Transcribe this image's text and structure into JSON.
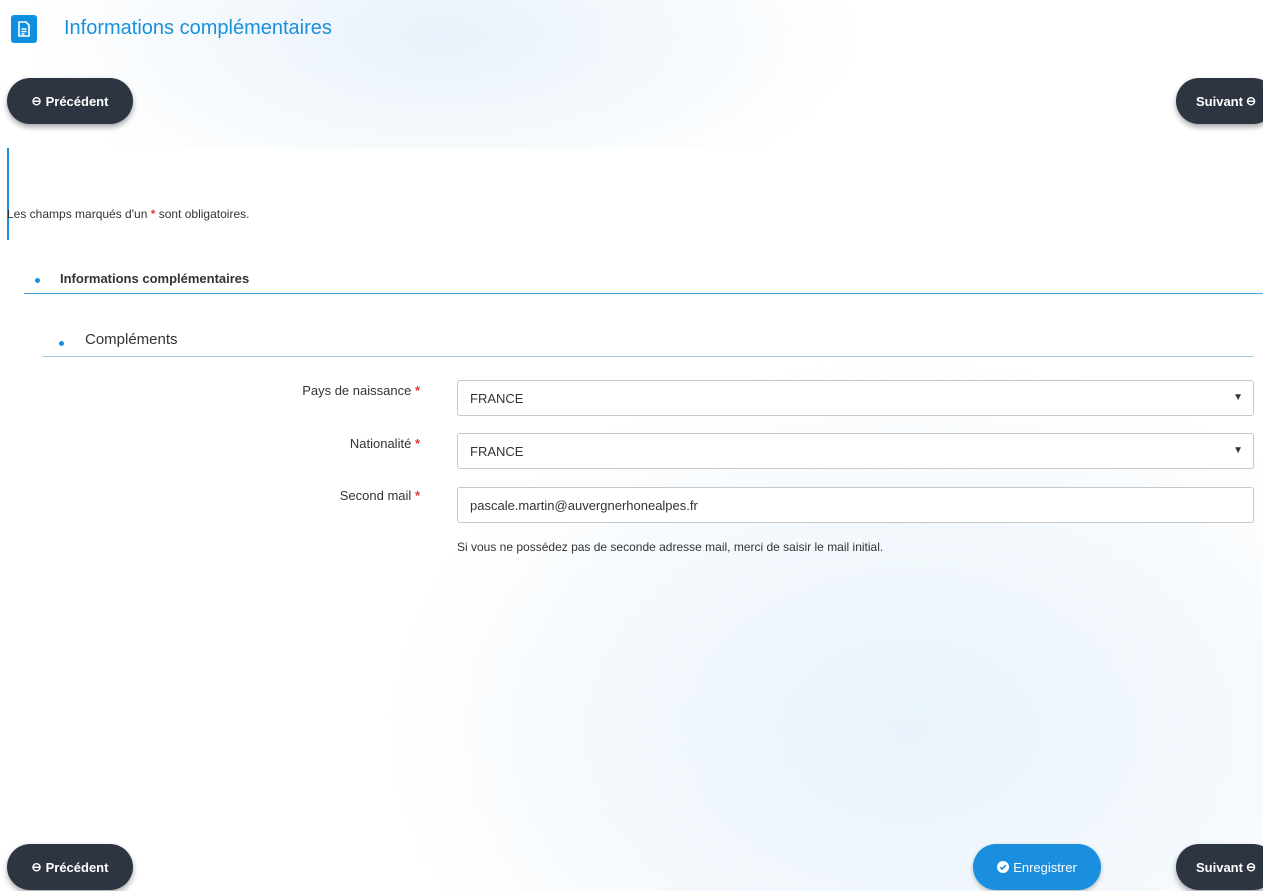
{
  "header": {
    "title": "Informations complémentaires",
    "icon": "document-icon"
  },
  "nav": {
    "prev_label": "Précédent",
    "next_label": "Suivant",
    "save_label": "Enregistrer"
  },
  "notice": {
    "before": "Les champs marqués d'un",
    "star": "*",
    "after": "sont obligatoires."
  },
  "section": {
    "title": "Informations complémentaires"
  },
  "subsection": {
    "title": "Compléments"
  },
  "form": {
    "birth_country": {
      "label": "Pays de naissance",
      "value": "FRANCE"
    },
    "nationality": {
      "label": "Nationalité",
      "value": "FRANCE"
    },
    "second_mail": {
      "label": "Second mail",
      "value": "pascale.martin@auvergnerhonealpes.fr",
      "help": "Si vous ne possédez pas de seconde adresse mail, merci de saisir le mail initial."
    },
    "required_marker": "*"
  },
  "colors": {
    "accent": "#1a8fe0",
    "nav_button": "#2d3442",
    "required": "#e33b3b"
  }
}
